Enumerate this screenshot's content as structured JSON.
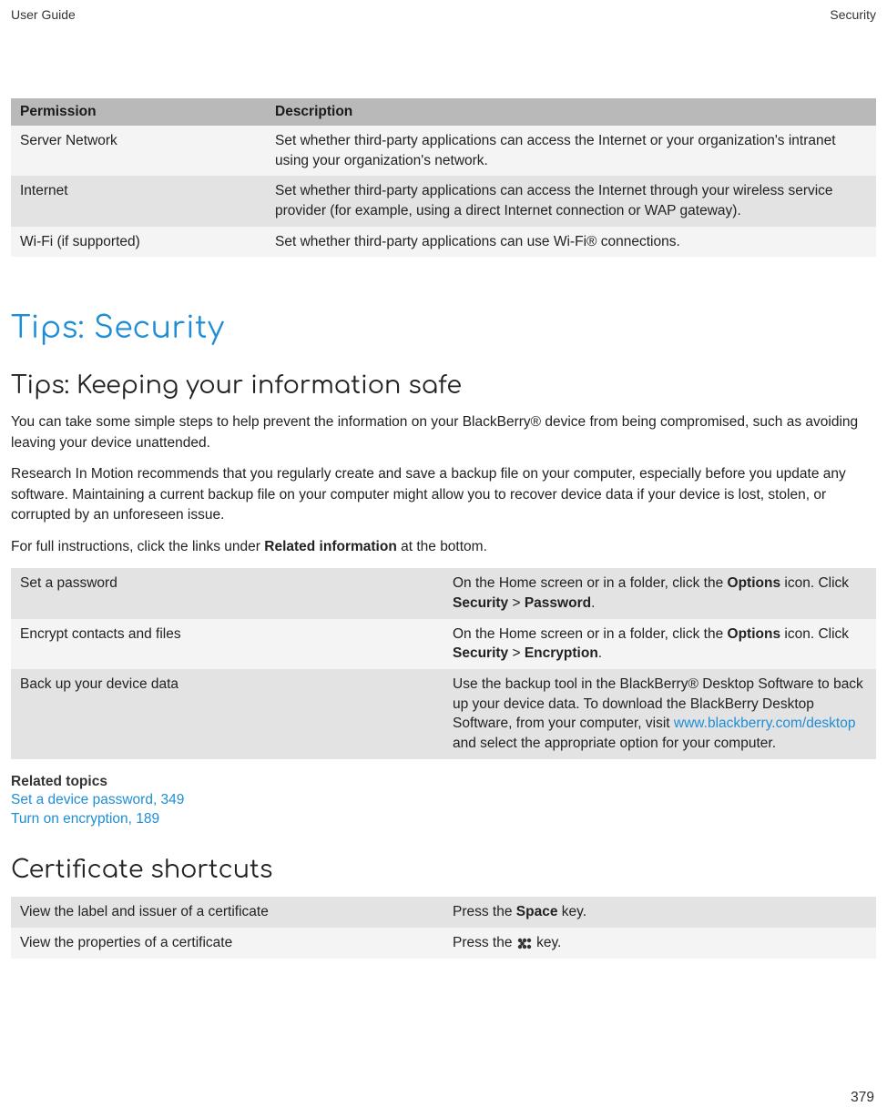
{
  "header": {
    "left": "User Guide",
    "right": "Security"
  },
  "table1": {
    "headers": {
      "permission": "Permission",
      "description": "Description"
    },
    "rows": [
      {
        "perm": "Server Network",
        "desc": "Set whether third-party applications can access the Internet or your organization's intranet using your organization's network."
      },
      {
        "perm": "Internet",
        "desc": "Set whether third-party applications can access the Internet through your wireless service provider (for example, using a direct Internet connection or WAP gateway)."
      },
      {
        "perm": "Wi-Fi (if supported)",
        "desc": "Set whether third-party applications can use Wi-Fi® connections."
      }
    ]
  },
  "headings": {
    "h1": "Tips: Security",
    "h2a": "Tips: Keeping your information safe",
    "h2b": "Certificate shortcuts"
  },
  "paragraphs": {
    "p1": "You can take some simple steps to help prevent the information on your BlackBerry® device from being compromised, such as avoiding leaving your device unattended.",
    "p2": "Research In Motion recommends that you regularly create and save a backup file on your computer, especially before you update any software. Maintaining a current backup file on your computer might allow you to recover device data if your device is lost, stolen, or corrupted by an unforeseen issue.",
    "p3_prefix": "For full instructions, click the links under ",
    "p3_bold": "Related information",
    "p3_suffix": " at the bottom."
  },
  "table2": {
    "rows": [
      {
        "left": "Set a password",
        "r_prefix": "On the Home screen or in a folder, click the ",
        "r_b1": "Options",
        "r_mid1": " icon. Click ",
        "r_b2": "Security",
        "r_mid2": " > ",
        "r_b3": "Password",
        "r_suffix": "."
      },
      {
        "left": "Encrypt contacts and files",
        "r_prefix": "On the Home screen or in a folder, click the ",
        "r_b1": "Options",
        "r_mid1": " icon. Click ",
        "r_b2": "Security",
        "r_mid2": " > ",
        "r_b3": "Encryption",
        "r_suffix": "."
      },
      {
        "left": "Back up your device data",
        "r_prefix": "Use the backup tool in the BlackBerry® Desktop Software to back up your device data. To download the BlackBerry Desktop Software, from your computer, visit ",
        "r_link": "www.blackberry.com/desktop",
        "r_suffix": " and select the appropriate option for your computer."
      }
    ]
  },
  "related": {
    "heading": "Related topics",
    "links": [
      "Set a device password, 349",
      "Turn on encryption, 189"
    ]
  },
  "table3": {
    "rows": [
      {
        "left": "View the label and issuer of a certificate",
        "r_prefix": "Press the ",
        "r_bold": "Space",
        "r_suffix": " key."
      },
      {
        "left": "View the properties of a certificate",
        "r_prefix": "Press the ",
        "r_icon": true,
        "r_suffix": " key."
      }
    ]
  },
  "page_number": "379"
}
